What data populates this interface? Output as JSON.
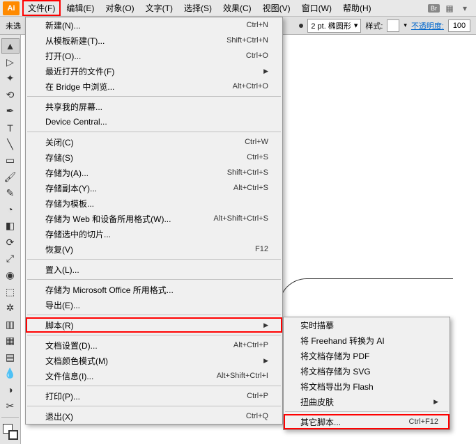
{
  "app_icon": "Ai",
  "menubar": {
    "items": [
      {
        "label": "文件(F)",
        "active": true
      },
      {
        "label": "编辑(E)"
      },
      {
        "label": "对象(O)"
      },
      {
        "label": "文字(T)"
      },
      {
        "label": "选择(S)"
      },
      {
        "label": "效果(C)"
      },
      {
        "label": "视图(V)"
      },
      {
        "label": "窗口(W)"
      },
      {
        "label": "帮助(H)"
      }
    ],
    "br_label": "Br"
  },
  "toolbar": {
    "left_label": "未选",
    "stroke_value": "2 pt. 椭圆形",
    "style_label": "样式:",
    "opacity_label": "不透明度:",
    "opacity_value": "100"
  },
  "file_menu": [
    {
      "label": "新建(N)...",
      "shortcut": "Ctrl+N"
    },
    {
      "label": "从模板新建(T)...",
      "shortcut": "Shift+Ctrl+N"
    },
    {
      "label": "打开(O)...",
      "shortcut": "Ctrl+O"
    },
    {
      "label": "最近打开的文件(F)",
      "arrow": true
    },
    {
      "label": "在 Bridge 中浏览...",
      "shortcut": "Alt+Ctrl+O"
    },
    {
      "sep": true
    },
    {
      "label": "共享我的屏幕..."
    },
    {
      "label": "Device Central..."
    },
    {
      "sep": true
    },
    {
      "label": "关闭(C)",
      "shortcut": "Ctrl+W"
    },
    {
      "label": "存储(S)",
      "shortcut": "Ctrl+S"
    },
    {
      "label": "存储为(A)...",
      "shortcut": "Shift+Ctrl+S"
    },
    {
      "label": "存储副本(Y)...",
      "shortcut": "Alt+Ctrl+S"
    },
    {
      "label": "存储为模板..."
    },
    {
      "label": "存储为 Web 和设备所用格式(W)...",
      "shortcut": "Alt+Shift+Ctrl+S"
    },
    {
      "label": "存储选中的切片..."
    },
    {
      "label": "恢复(V)",
      "shortcut": "F12"
    },
    {
      "sep": true
    },
    {
      "label": "置入(L)..."
    },
    {
      "sep": true
    },
    {
      "label": "存储为 Microsoft Office 所用格式..."
    },
    {
      "label": "导出(E)..."
    },
    {
      "sep": true
    },
    {
      "label": "脚本(R)",
      "arrow": true,
      "hl": true
    },
    {
      "sep": true
    },
    {
      "label": "文档设置(D)...",
      "shortcut": "Alt+Ctrl+P"
    },
    {
      "label": "文档颜色模式(M)",
      "arrow": true
    },
    {
      "label": "文件信息(I)...",
      "shortcut": "Alt+Shift+Ctrl+I"
    },
    {
      "sep": true
    },
    {
      "label": "打印(P)...",
      "shortcut": "Ctrl+P"
    },
    {
      "sep": true
    },
    {
      "label": "退出(X)",
      "shortcut": "Ctrl+Q"
    }
  ],
  "script_submenu": [
    {
      "label": "实时描摹"
    },
    {
      "label": "将 Freehand 转换为 AI"
    },
    {
      "label": "将文档存储为 PDF"
    },
    {
      "label": "将文档存储为 SVG"
    },
    {
      "label": "将文档导出为 Flash"
    },
    {
      "label": "扭曲皮肤",
      "arrow": true
    },
    {
      "sep": true
    },
    {
      "label": "其它脚本...",
      "shortcut": "Ctrl+F12",
      "hl": true
    }
  ]
}
